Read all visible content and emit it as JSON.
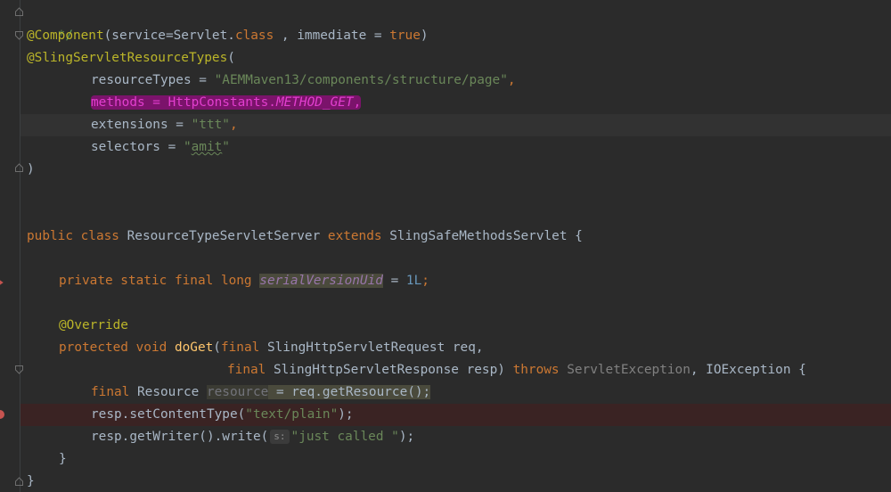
{
  "editor": {
    "theme_colors": {
      "background": "#2b2b2b",
      "keyword": "#cc7832",
      "annotation": "#bbb529",
      "string": "#6a8759",
      "number": "#6897bb",
      "function": "#ffc66d",
      "field": "#9876aa",
      "highlight_pen": "#be00a0"
    },
    "code": {
      "l1_comment": "*/",
      "l2_ann": "@Component",
      "l2_rest1": "(service=Servlet.",
      "l2_kw": "class",
      "l2_rest2": " , immediate = ",
      "l2_val": "true",
      "l2_end": ")",
      "l3_ann": "@SlingServletResourceTypes",
      "l3_end": "(",
      "l4_key": "resourceTypes = ",
      "l4_str": "\"AEMMaven13/components/structure/page\"",
      "l4_end": ",",
      "l5_key": "methods = HttpConstants.",
      "l5_const": "METHOD_GET",
      "l5_end": ",",
      "l6_key": "extensions = ",
      "l6_str": "\"ttt\"",
      "l6_end": ",",
      "l7_key": "selectors = ",
      "l7_q1": "\"",
      "l7_word": "amit",
      "l7_q2": "\"",
      "l8_close": ")",
      "l9_kw1": "public class",
      "l9_name": " ResourceTypeServletServer ",
      "l9_kw2": "extends",
      "l9_rest": " SlingSafeMethodsServlet {",
      "l10_kw": "private static final long",
      "l10_field": "serialVersionUid",
      "l10_eq": " = ",
      "l10_num": "1L",
      "l10_end": ";",
      "l11_ann": "@Override",
      "l12_kw": "protected void",
      "l12_fn": "doGet",
      "l12_open": "(",
      "l12_kw2": "final",
      "l12_rest": " SlingHttpServletRequest req,",
      "l13_kw": "final",
      "l13_rest": " SlingHttpServletResponse resp) ",
      "l13_kw2": "throws",
      "l13_ex1": "ServletException",
      "l13_rest2": ", IOException {",
      "l14_kw": "final",
      "l14_type": " Resource ",
      "l14_var": "resource",
      "l14_rest": " = req.getResource();",
      "l15_code": "resp.setContentType(",
      "l15_str": "\"text/plain\"",
      "l15_end": ");",
      "l16_code": "resp.getWriter().write(",
      "l16_hint": "s:",
      "l16_str": "\"just called \"",
      "l16_end": ");",
      "l17_close": "}",
      "l18_close": "}"
    }
  }
}
